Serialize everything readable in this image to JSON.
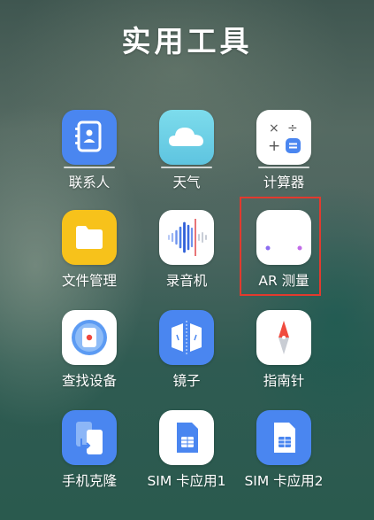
{
  "folder": {
    "title": "实用工具"
  },
  "apps": [
    {
      "name": "联系人",
      "icon": "contacts-icon"
    },
    {
      "name": "天气",
      "icon": "weather-cloud-icon"
    },
    {
      "name": "计算器",
      "icon": "calculator-icon"
    },
    {
      "name": "文件管理",
      "icon": "folder-icon"
    },
    {
      "name": "录音机",
      "icon": "recorder-waveform-icon"
    },
    {
      "name": "AR 测量",
      "icon": "ar-ruler-icon",
      "highlighted": true
    },
    {
      "name": "查找设备",
      "icon": "find-device-icon"
    },
    {
      "name": "镜子",
      "icon": "mirror-icon"
    },
    {
      "name": "指南针",
      "icon": "compass-icon"
    },
    {
      "name": "手机克隆",
      "icon": "phone-clone-icon"
    },
    {
      "name": "SIM 卡应用1",
      "icon": "sim-card-icon"
    },
    {
      "name": "SIM 卡应用2",
      "icon": "sim-card-icon"
    }
  ],
  "colors": {
    "blue": "#4a86f0",
    "highlight": "#e23a2e",
    "folder_yellow": "#f7c21b",
    "compass_red": "#f04b3e",
    "sky": "#6fd0e8"
  }
}
